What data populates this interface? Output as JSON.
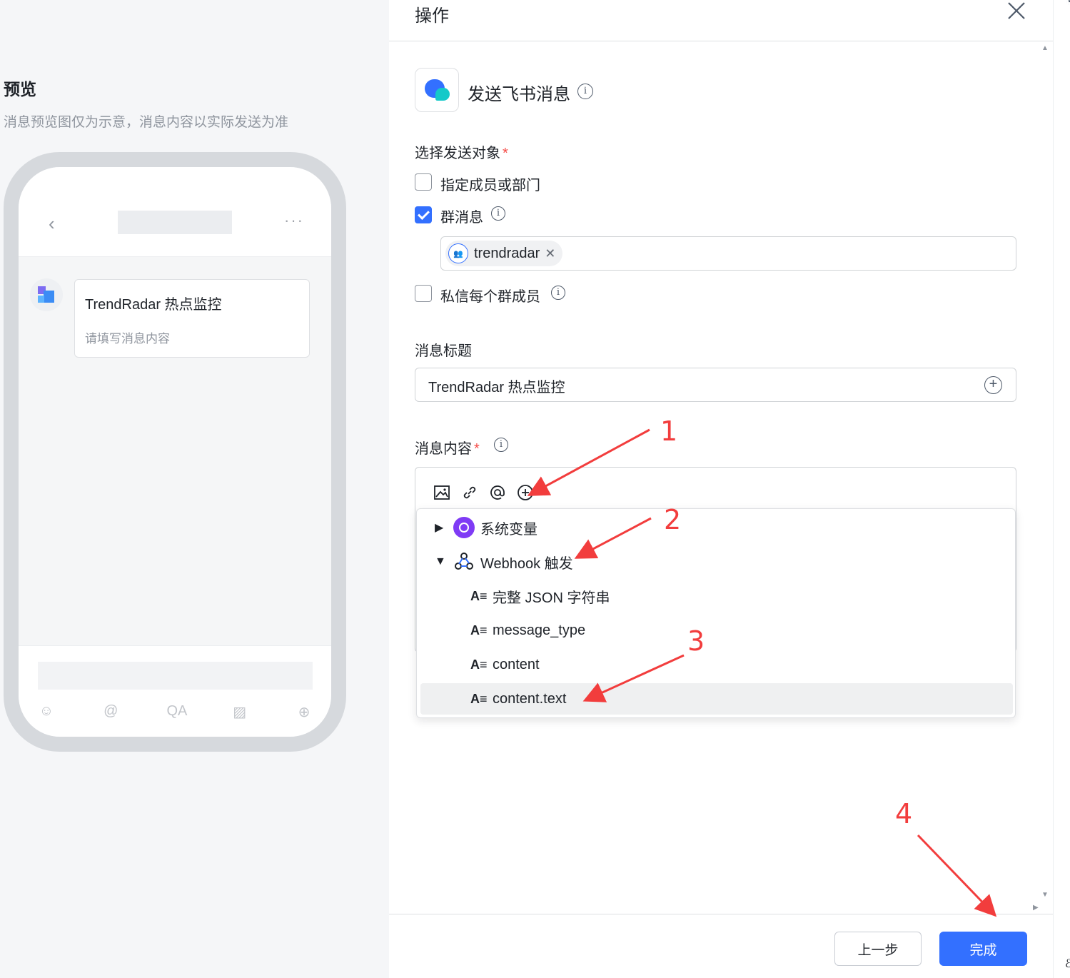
{
  "preview": {
    "title": "预览",
    "subtitle": "消息预览图仅为示意，消息内容以实际发送为准",
    "card_title": "TrendRadar 热点监控",
    "card_body": "请填写消息内容",
    "back_glyph": "‹",
    "more_glyph": "···",
    "tool_glyphs": [
      "☺",
      "@",
      "QA",
      "▨",
      "⊕"
    ]
  },
  "drawer": {
    "title": "操作",
    "app_name": "发送飞书消息",
    "recipients_label": "选择发送对象",
    "required_mark": "*",
    "options": [
      {
        "label": "指定成员或部门",
        "checked": false
      },
      {
        "label": "群消息",
        "checked": true
      },
      {
        "label": "私信每个群成员",
        "checked": false
      }
    ],
    "chip_text": "trendradar",
    "chip_remove": "✕",
    "title_label": "消息标题",
    "title_value": "TrendRadar 热点监控",
    "content_label": "消息内容",
    "info_glyph": "i",
    "plus_glyph": "+"
  },
  "variable_menu": {
    "groups": [
      {
        "label": "系统变量",
        "expanded": false,
        "caret": "▶"
      },
      {
        "label": "Webhook 触发",
        "expanded": true,
        "caret": "▼"
      }
    ],
    "type_glyph": "A≡",
    "items": [
      "完整 JSON 字符串",
      "message_type",
      "content",
      "content.text"
    ],
    "active_item": "content.text"
  },
  "footer": {
    "prev_label": "上一步",
    "done_label": "完成"
  },
  "annotations": [
    "1",
    "2",
    "3",
    "4"
  ],
  "colors": {
    "primary": "#3370ff",
    "annotation": "#f23d3d",
    "required": "#f54a45",
    "system_var": "#7f3bf5"
  }
}
